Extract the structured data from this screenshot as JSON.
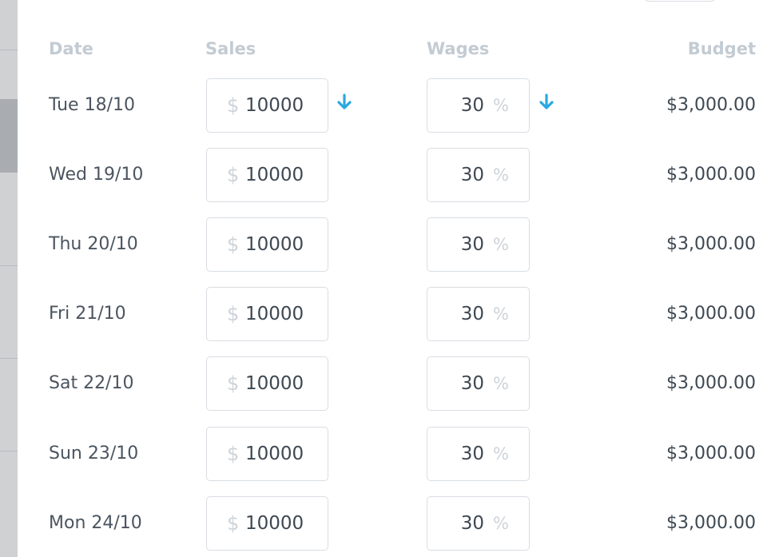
{
  "columns": {
    "date": "Date",
    "sales": "Sales",
    "wages": "Wages",
    "budget": "Budget"
  },
  "currency_symbol": "$",
  "percent_symbol": "%",
  "accent_color": "#29a8e0",
  "rows": [
    {
      "date": "Tue 18/10",
      "sales": "10000",
      "wages": "30",
      "budget": "$3,000.00"
    },
    {
      "date": "Wed 19/10",
      "sales": "10000",
      "wages": "30",
      "budget": "$3,000.00"
    },
    {
      "date": "Thu 20/10",
      "sales": "10000",
      "wages": "30",
      "budget": "$3,000.00"
    },
    {
      "date": "Fri 21/10",
      "sales": "10000",
      "wages": "30",
      "budget": "$3,000.00"
    },
    {
      "date": "Sat 22/10",
      "sales": "10000",
      "wages": "30",
      "budget": "$3,000.00"
    },
    {
      "date": "Sun 23/10",
      "sales": "10000",
      "wages": "30",
      "budget": "$3,000.00"
    },
    {
      "date": "Mon 24/10",
      "sales": "10000",
      "wages": "30",
      "budget": "$3,000.00"
    }
  ],
  "icons": {
    "copy_down": "arrow-down-icon"
  }
}
